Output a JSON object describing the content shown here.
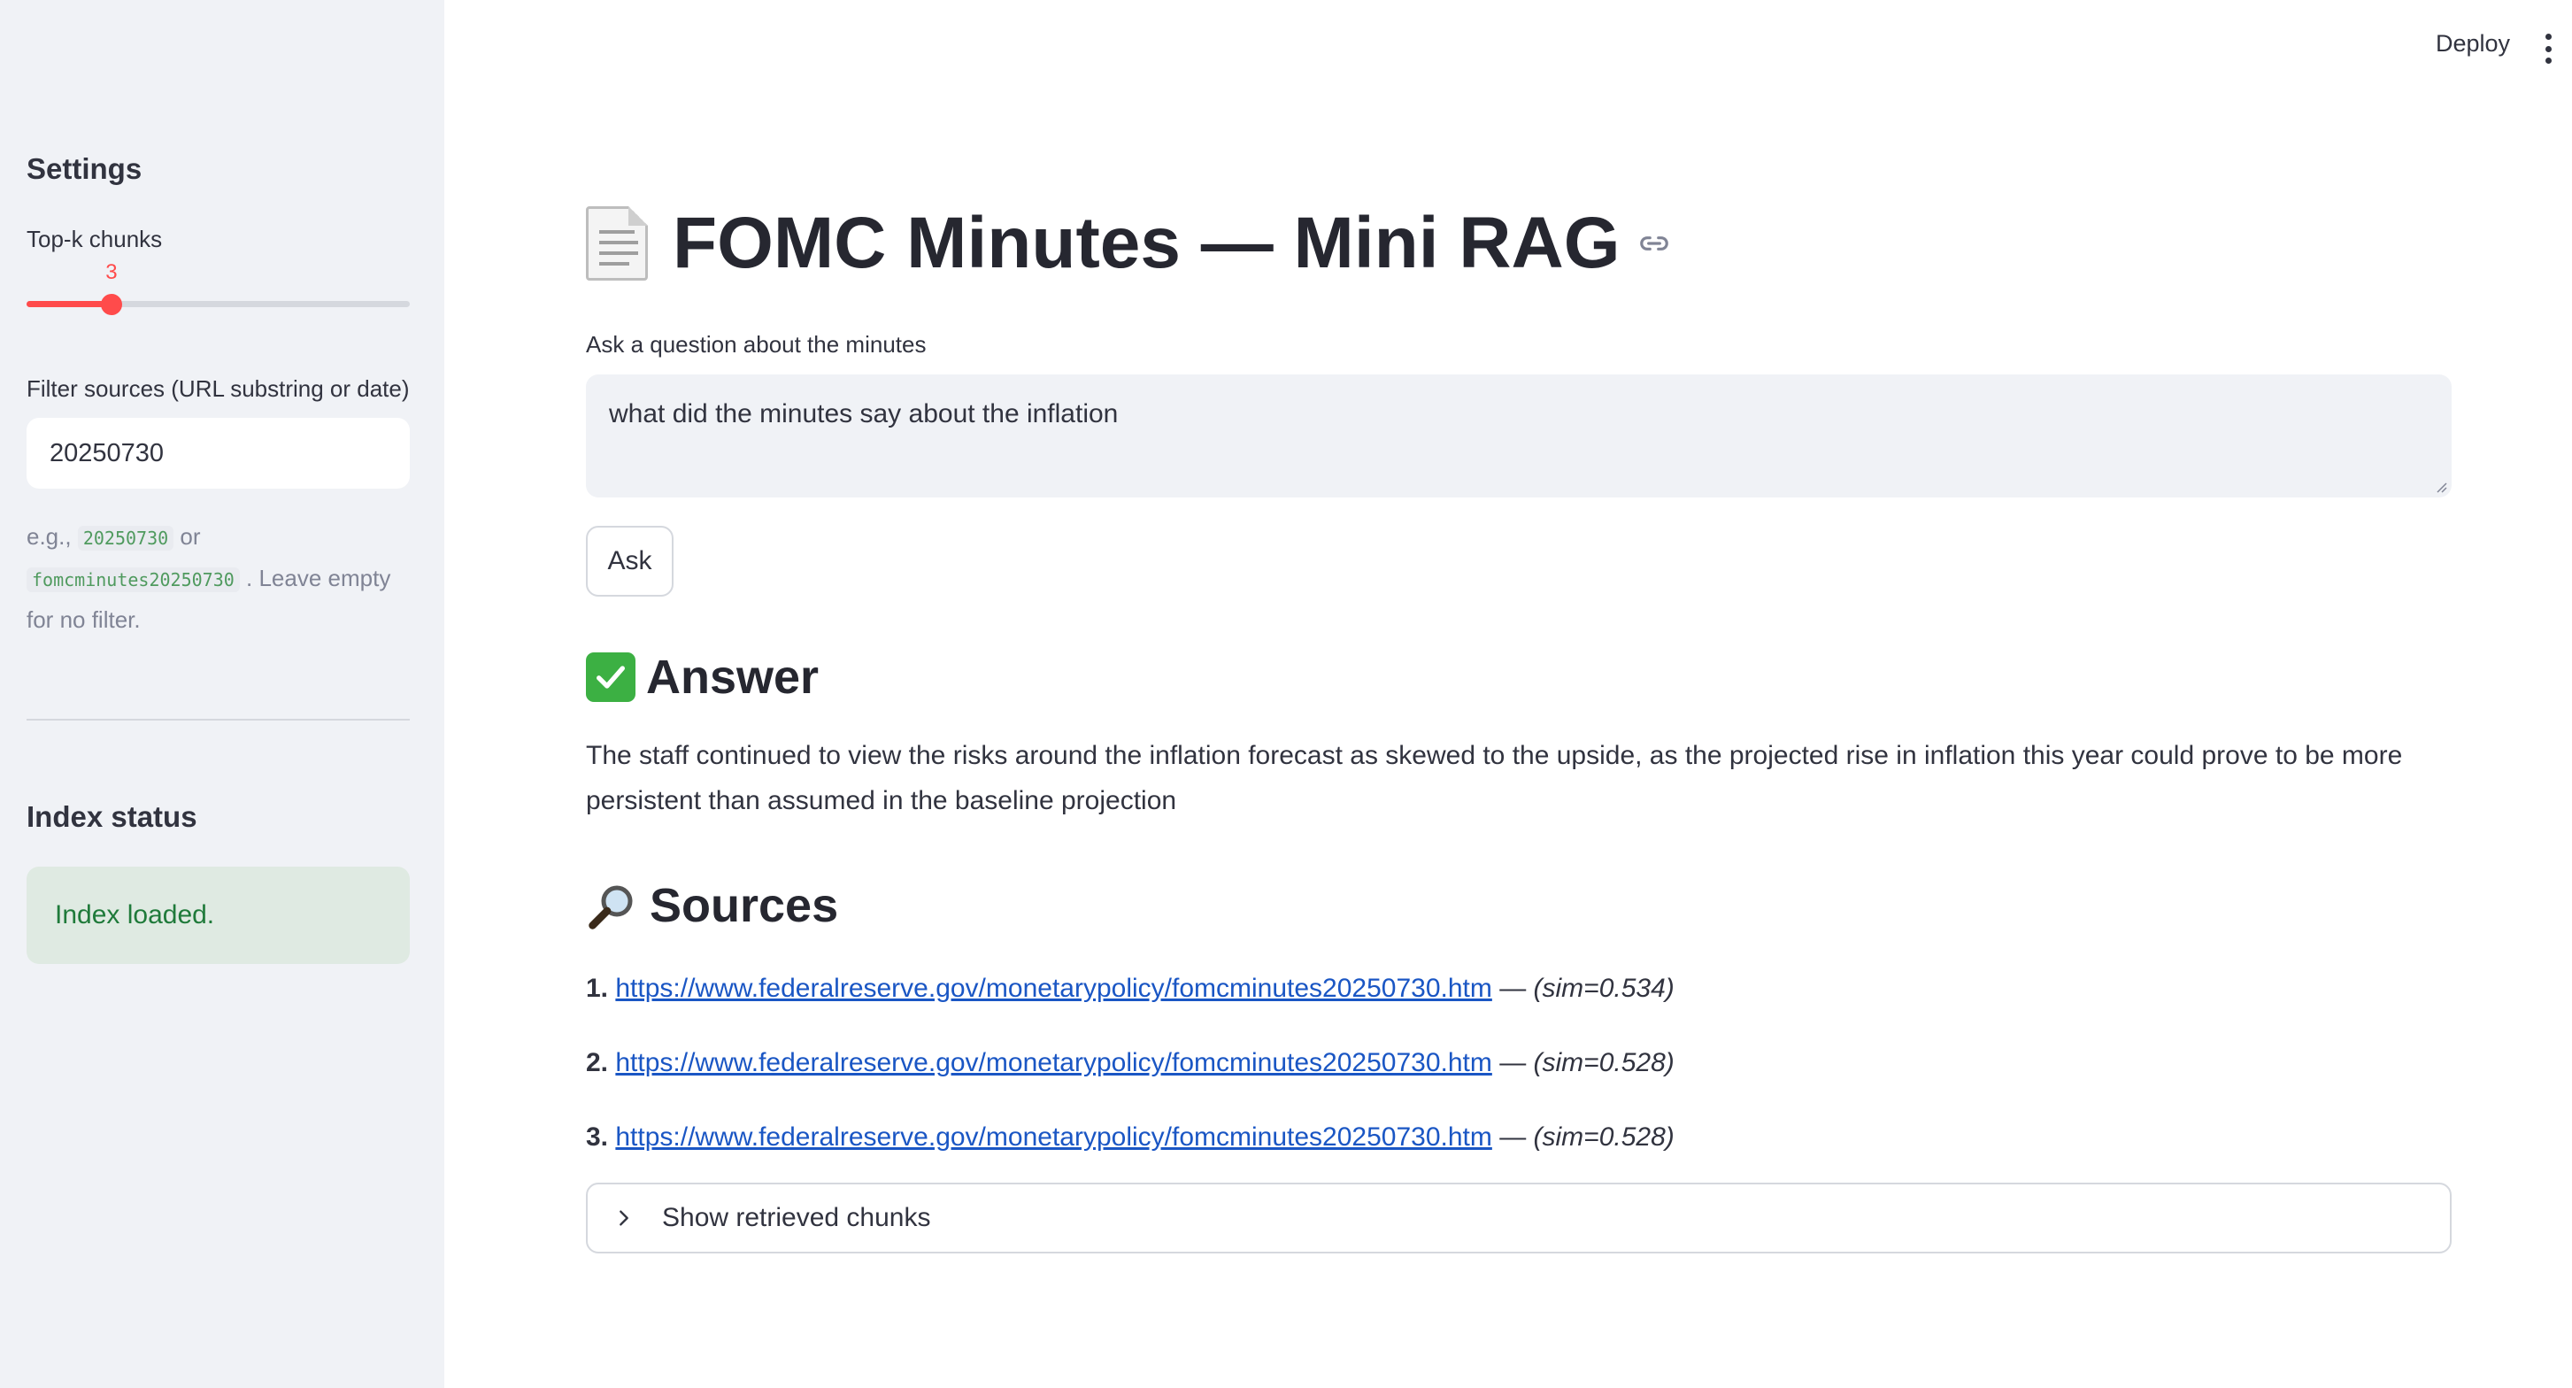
{
  "topbar": {
    "deploy_label": "Deploy",
    "menu_icon": "kebab-menu-icon"
  },
  "sidebar": {
    "settings_heading": "Settings",
    "topk": {
      "label": "Top-k chunks",
      "value": 3,
      "value_text": "3",
      "min": 1,
      "max": 10
    },
    "filter": {
      "label": "Filter sources (URL substring or date)",
      "value": "20250730",
      "help_prefix": "e.g.,",
      "help_code1": "20250730",
      "help_or": "or",
      "help_code2": "fomcminutes20250730",
      "help_suffix": ". Leave empty for no filter."
    },
    "index_heading": "Index status",
    "index_status": "Index loaded."
  },
  "main": {
    "title": "FOMC Minutes — Mini RAG",
    "title_icon": "document-icon",
    "question_label": "Ask a question about the minutes",
    "question_value": "what did the minutes say about the inflation",
    "ask_button": "Ask",
    "answer_heading": "Answer",
    "answer_icon": "check-mark-icon",
    "answer_text": "The staff continued to view the risks around the inflation forecast as skewed to the upside, as the projected rise in inflation this year could prove to be more persistent than assumed in the baseline projection",
    "sources_heading": "Sources",
    "sources_icon": "magnifier-icon",
    "sources": [
      {
        "num": "1.",
        "url": "https://www.federalreserve.gov/monetarypolicy/fomcminutes20250730.htm",
        "sep": " — ",
        "sim": "(sim=0.534)"
      },
      {
        "num": "2.",
        "url": "https://www.federalreserve.gov/monetarypolicy/fomcminutes20250730.htm",
        "sep": " — ",
        "sim": "(sim=0.528)"
      },
      {
        "num": "3.",
        "url": "https://www.federalreserve.gov/monetarypolicy/fomcminutes20250730.htm",
        "sep": " — ",
        "sim": "(sim=0.528)"
      }
    ],
    "expander_label": "Show retrieved chunks"
  },
  "colors": {
    "accent": "#ff4b4b",
    "sidebar_bg": "#f0f2f6",
    "success_bg": "#dfeae2",
    "success_text": "#1f7a3a",
    "link": "#1a56c4"
  }
}
